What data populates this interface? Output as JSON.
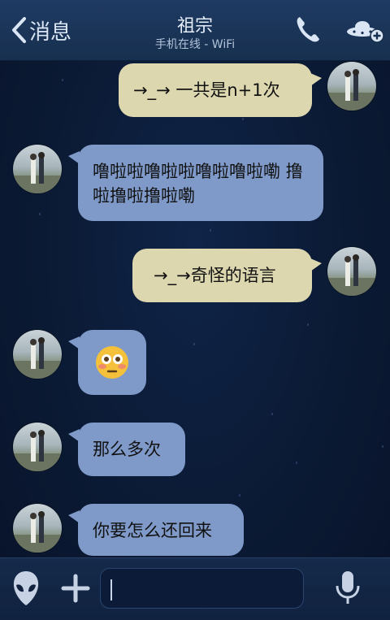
{
  "header": {
    "back_label": "消息",
    "title": "祖宗",
    "status": "手机在线 - WiFi"
  },
  "messages": [
    {
      "side": "out",
      "text": "→_→ 一共是n+1次"
    },
    {
      "side": "in",
      "text": "噜啦啦噜啦啦噜啦噜啦嘞 撸啦撸啦撸啦嘞"
    },
    {
      "side": "out",
      "text": "→_→奇怪的语言"
    },
    {
      "side": "in",
      "emoji": "😳"
    },
    {
      "side": "in",
      "text": "那么多次"
    },
    {
      "side": "in",
      "text": "你要怎么还回来"
    }
  ],
  "composer": {
    "value": ""
  },
  "icons": {
    "back": "chevron-left-icon",
    "phone": "phone-icon",
    "ufo": "ufo-add-icon",
    "alien": "alien-emoji-icon",
    "plus": "plus-icon",
    "mic": "microphone-icon"
  }
}
